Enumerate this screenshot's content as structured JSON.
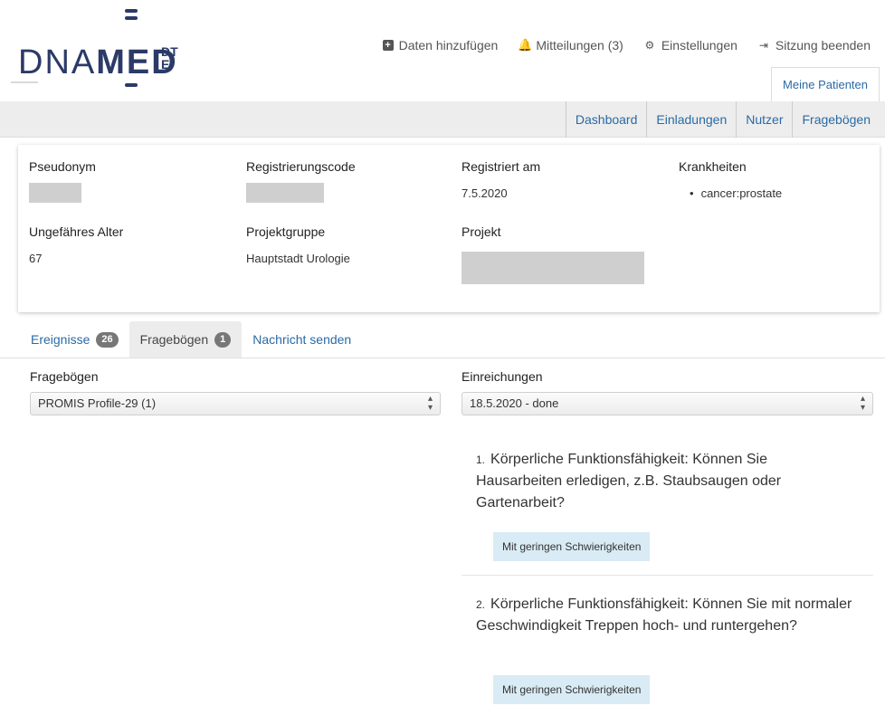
{
  "logo": {
    "text_light": "DNA",
    "text_bold": "MED",
    "suffix_line1": "DT",
    "suffix_line2": "E"
  },
  "topnav": [
    {
      "icon": "plus-square-icon",
      "label": "Daten hinzufügen"
    },
    {
      "icon": "bell-icon",
      "label": "Mitteilungen (3)"
    },
    {
      "icon": "gears-icon",
      "label": "Einstellungen"
    },
    {
      "icon": "sign-out-icon",
      "label": "Sitzung beenden"
    }
  ],
  "meine_patienten": "Meine Patienten",
  "subnav": [
    "Dashboard",
    "Einladungen",
    "Nutzer",
    "Fragebögen"
  ],
  "patient": {
    "pseudonym_label": "Pseudonym",
    "regcode_label": "Registrierungscode",
    "registered_label": "Registriert am",
    "registered_value": "7.5.2020",
    "diseases_label": "Krankheiten",
    "diseases": [
      "cancer:prostate"
    ],
    "age_label": "Ungefähres Alter",
    "age_value": "67",
    "group_label": "Projektgruppe",
    "group_value": "Hauptstadt Urologie",
    "project_label": "Projekt"
  },
  "tabs": [
    {
      "label": "Ereignisse",
      "badge": "26"
    },
    {
      "label": "Fragebögen",
      "badge": "1"
    },
    {
      "label": "Nachricht senden",
      "badge": ""
    }
  ],
  "questionnaire": {
    "label": "Fragebögen",
    "selected": "PROMIS Profile-29 (1)",
    "submissions_label": "Einreichungen",
    "submission_selected": "18.5.2020 - done"
  },
  "questions": [
    {
      "num": "1.",
      "text": "Körperliche Funktionsfähigkeit: Können Sie Hausarbeiten erledigen, z.B. Staubsaugen oder Gartenarbeit?",
      "answer": "Mit geringen Schwierigkeiten"
    },
    {
      "num": "2.",
      "text": "Körperliche Funktionsfähigkeit: Können Sie mit normaler Geschwindigkeit Treppen hoch- und runtergehen?",
      "answer": "Mit geringen Schwierigkeiten"
    }
  ],
  "colors": {
    "brand": "#2b3a67",
    "link": "#2a6aa5",
    "bell": "#f0b400",
    "answer_bg": "#d9ebf5"
  }
}
